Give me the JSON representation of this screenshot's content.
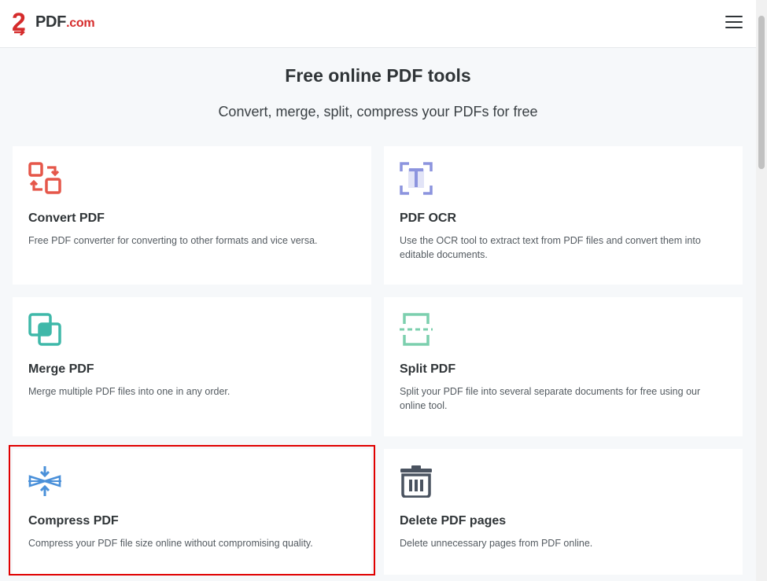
{
  "header": {
    "logo_number": "2",
    "logo_text": "PDF",
    "logo_domain": ".com",
    "menu_icon": "hamburger-menu-icon"
  },
  "hero": {
    "title": "Free online PDF tools",
    "subtitle": "Convert, merge, split, compress your PDFs for free"
  },
  "cards": [
    {
      "title": "Convert PDF",
      "desc": "Free PDF converter for converting to other formats and vice versa.",
      "icon": "convert-icon",
      "color": "#e5574a"
    },
    {
      "title": "PDF OCR",
      "desc": "Use the OCR tool to extract text from PDF files and convert them into editable documents.",
      "icon": "ocr-icon",
      "color": "#8c94de"
    },
    {
      "title": "Merge PDF",
      "desc": "Merge multiple PDF files into one in any order.",
      "icon": "merge-icon",
      "color": "#3fb8a9"
    },
    {
      "title": "Split PDF",
      "desc": "Split your PDF file into several separate documents for free using our online tool.",
      "icon": "split-icon",
      "color": "#7ccfae"
    },
    {
      "title": "Compress PDF",
      "desc": "Compress your PDF file size online without compromising quality.",
      "icon": "compress-icon",
      "color": "#4a90d9"
    },
    {
      "title": "Delete PDF pages",
      "desc": "Delete unnecessary pages from PDF online.",
      "icon": "trash-icon",
      "color": "#4a5360"
    }
  ],
  "colors": {
    "brand_red": "#d52b2b",
    "highlight_border": "#e00000",
    "page_background": "#f6f8fa"
  }
}
